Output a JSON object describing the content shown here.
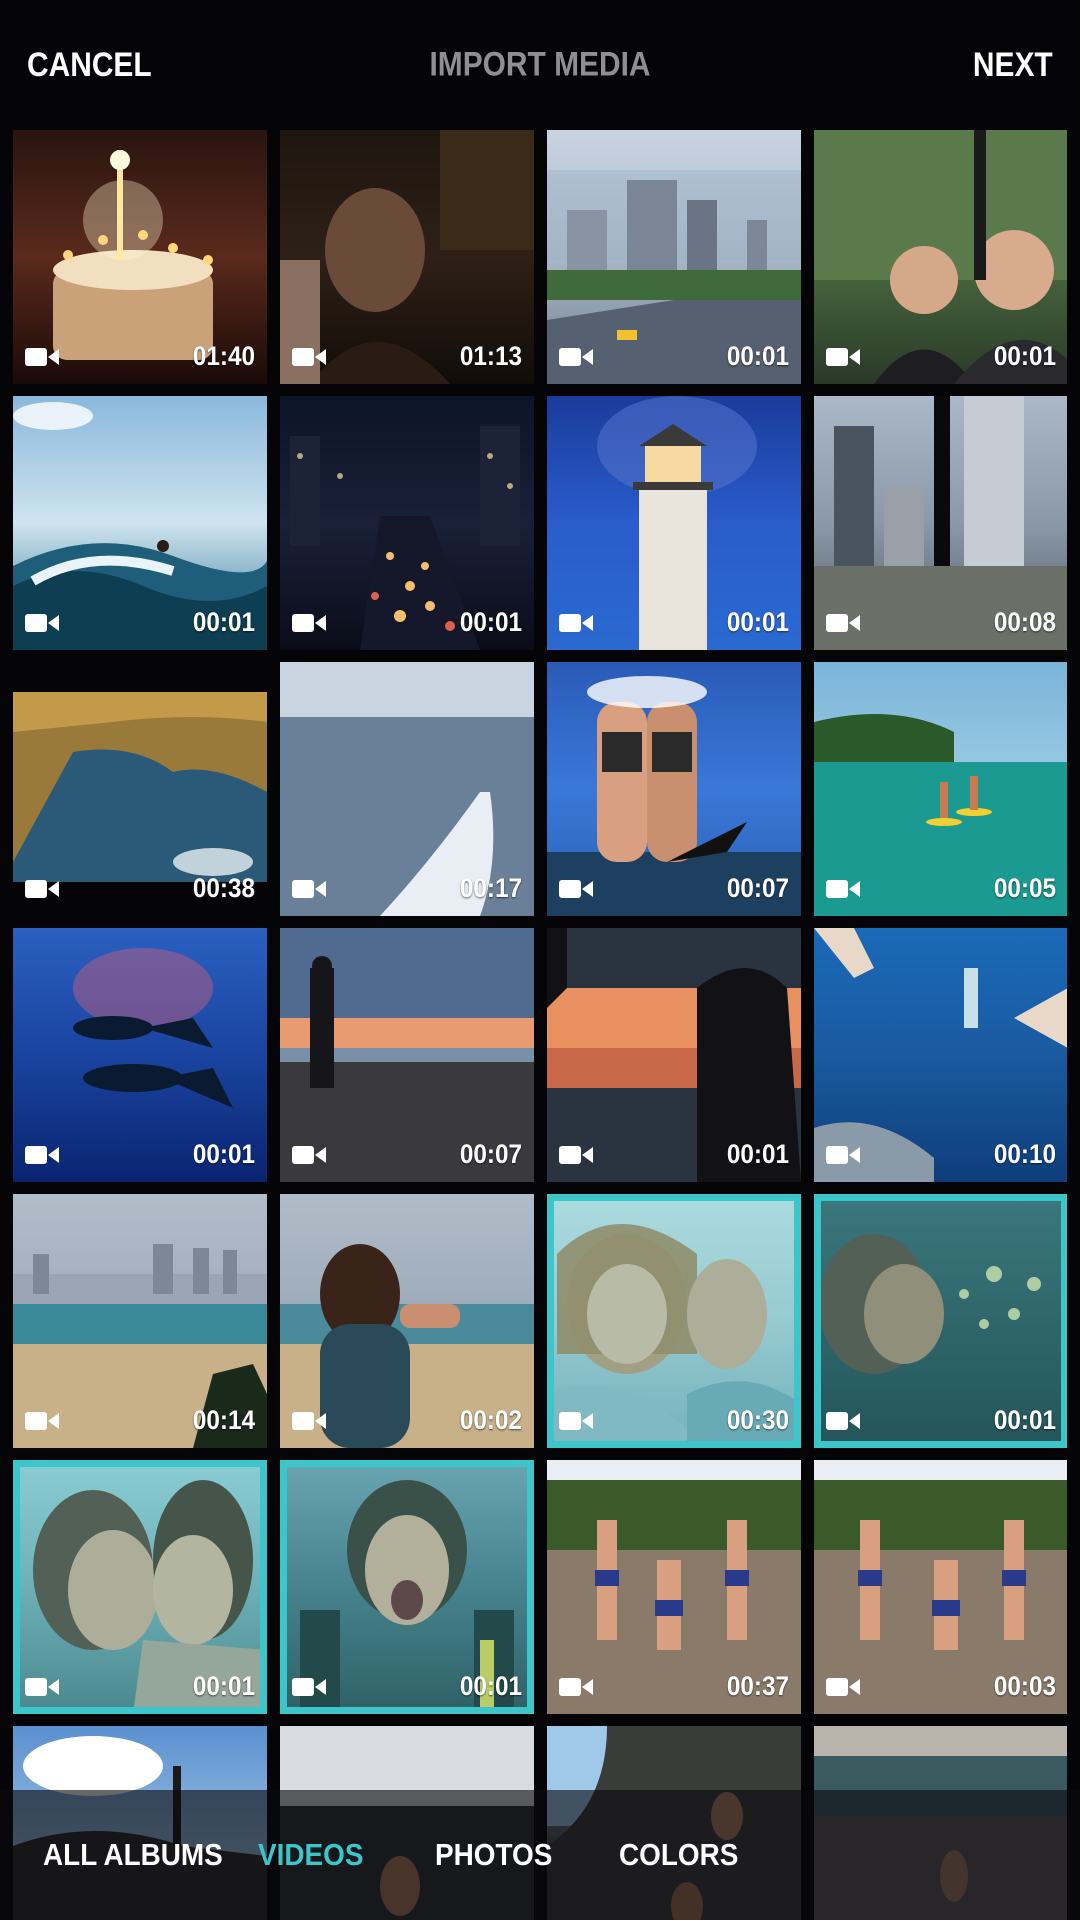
{
  "header": {
    "cancel_label": "CANCEL",
    "title": "IMPORT MEDIA",
    "next_label": "NEXT"
  },
  "colors": {
    "background": "#050508",
    "accent": "#3cc6c9",
    "title_gray": "#8e8e93"
  },
  "media": [
    {
      "duration": "01:40",
      "scene": "birthday-cake-candles",
      "selected": false
    },
    {
      "duration": "01:13",
      "scene": "woman-dark-restaurant",
      "selected": false
    },
    {
      "duration": "00:01",
      "scene": "city-highway",
      "selected": false
    },
    {
      "duration": "00:01",
      "scene": "two-men-selfie",
      "selected": false
    },
    {
      "duration": "00:01",
      "scene": "surfer-wave",
      "selected": false
    },
    {
      "duration": "00:01",
      "scene": "night-city-traffic",
      "selected": false
    },
    {
      "duration": "00:01",
      "scene": "lighthouse",
      "selected": false
    },
    {
      "duration": "00:08",
      "scene": "skyscrapers-view",
      "selected": false
    },
    {
      "duration": "00:38",
      "scene": "coastal-cliffs",
      "selected": false
    },
    {
      "duration": "00:17",
      "scene": "boat-wake",
      "selected": false
    },
    {
      "duration": "00:07",
      "scene": "divers-on-boat",
      "selected": false
    },
    {
      "duration": "00:05",
      "scene": "paddleboarders",
      "selected": false
    },
    {
      "duration": "00:01",
      "scene": "underwater-divers",
      "selected": false
    },
    {
      "duration": "00:07",
      "scene": "couple-sunset-beach",
      "selected": false
    },
    {
      "duration": "00:01",
      "scene": "silhouette-sunset",
      "selected": false
    },
    {
      "duration": "00:10",
      "scene": "underwater-swimmer",
      "selected": false
    },
    {
      "duration": "00:14",
      "scene": "beach-skyline",
      "selected": false
    },
    {
      "duration": "00:02",
      "scene": "woman-taking-photo",
      "selected": false
    },
    {
      "duration": "00:30",
      "scene": "two-women-laughing",
      "selected": true
    },
    {
      "duration": "00:01",
      "scene": "women-bokeh",
      "selected": true
    },
    {
      "duration": "00:01",
      "scene": "two-women-close",
      "selected": true
    },
    {
      "duration": "00:01",
      "scene": "woman-rollercoaster",
      "selected": true
    },
    {
      "duration": "00:37",
      "scene": "friends-beach-running",
      "selected": false
    },
    {
      "duration": "00:03",
      "scene": "friends-beach-running-2",
      "selected": false
    },
    {
      "duration": "",
      "scene": "person-on-rock-sky",
      "selected": false
    },
    {
      "duration": "",
      "scene": "waterfall-swimmer",
      "selected": false
    },
    {
      "duration": "",
      "scene": "cliff-climbers",
      "selected": false
    },
    {
      "duration": "",
      "scene": "rock-pool-person",
      "selected": false
    }
  ],
  "tabs": {
    "albums": "ALL ALBUMS",
    "videos": "VIDEOS",
    "photos": "PHOTOS",
    "colors": "COLORS",
    "active": "videos"
  },
  "icons": {
    "video": "video-camera-icon"
  }
}
